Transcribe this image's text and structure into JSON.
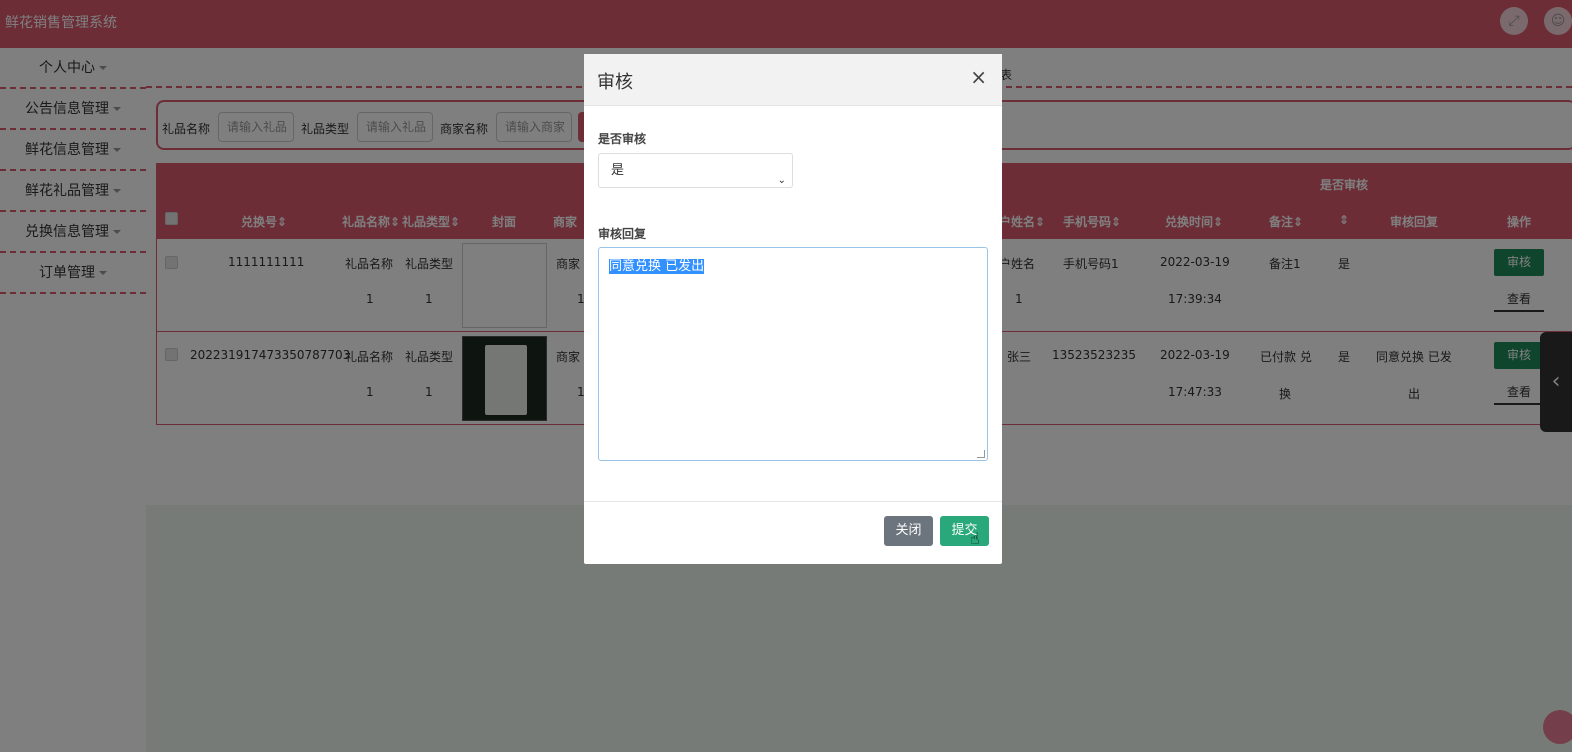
{
  "app": {
    "title": "鲜花销售管理系统"
  },
  "sidebar": {
    "items": [
      {
        "label": "个人中心"
      },
      {
        "label": "公告信息管理"
      },
      {
        "label": "鲜花信息管理"
      },
      {
        "label": "鲜花礼品管理"
      },
      {
        "label": "兑换信息管理"
      },
      {
        "label": "订单管理"
      }
    ]
  },
  "breadcrumb": {
    "tail": "表"
  },
  "search": {
    "gift_name_label": "礼品名称",
    "gift_name_placeholder": "请输入礼品",
    "gift_type_label": "礼品类型",
    "gift_type_placeholder": "请输入礼品",
    "merchant_label": "商家名称",
    "merchant_placeholder": "请输入商家"
  },
  "table": {
    "group_header": "是否审核",
    "headers": {
      "exchange_no": "兑换号",
      "gift_name": "礼品名称",
      "gift_type": "礼品类型",
      "cover": "封面",
      "merchant": "商家",
      "user_name": "户姓名",
      "phone": "手机号码",
      "exchange_time": "兑换时间",
      "remark": "备注",
      "audit_reply": "审核回复",
      "actions": "操作"
    },
    "rows": [
      {
        "exchange_no": "1111111111",
        "gift_name_1": "礼品名称",
        "gift_name_2": "1",
        "gift_type_1": "礼品类型",
        "gift_type_2": "1",
        "merchant_1": "商家",
        "merchant_2": "1",
        "user_name_1": "户姓名",
        "user_name_2": "1",
        "phone": "手机号码1",
        "date": "2022-03-19",
        "time": "17:39:34",
        "remark_1": "备注1",
        "remark_2": "",
        "audited": "是",
        "reply_1": "",
        "reply_2": "",
        "audit_btn": "审核",
        "view_btn": "查看"
      },
      {
        "exchange_no": "202231917473350787703",
        "gift_name_1": "礼品名称",
        "gift_name_2": "1",
        "gift_type_1": "礼品类型",
        "gift_type_2": "1",
        "merchant_1": "商家",
        "merchant_2": "1",
        "user_name_1": "张三",
        "user_name_2": "",
        "phone": "13523523235",
        "date": "2022-03-19",
        "time": "17:47:33",
        "remark_1": "已付款 兑",
        "remark_2": "换",
        "audited": "是",
        "reply_1": "同意兑换 已发",
        "reply_2": "出",
        "audit_btn": "审核",
        "view_btn": "查看"
      }
    ]
  },
  "modal": {
    "title": "审核",
    "close_glyph": "×",
    "audit_label": "是否审核",
    "audit_value": "是",
    "reply_label": "审核回复",
    "reply_value": "同意兑换 已发出",
    "close_button": "关闭",
    "submit_button": "提交"
  },
  "icons": {
    "fullscreen": "fullscreen-icon",
    "user": "user-icon",
    "collapse": "chevron-left-icon",
    "sort": "sort-icon"
  },
  "colors": {
    "brand": "#d85a6e",
    "success": "#1f8a5b",
    "submit": "#28a87b",
    "secondary": "#6c757d"
  }
}
